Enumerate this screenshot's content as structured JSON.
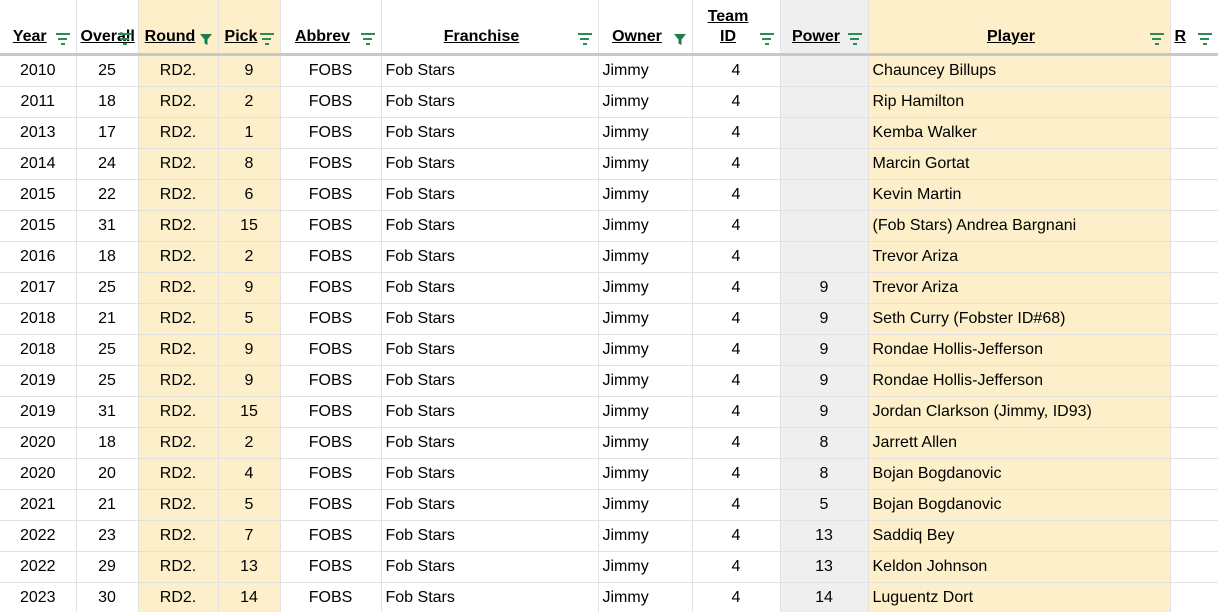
{
  "headers": {
    "year": "Year",
    "overall": "Overall",
    "round": "Round",
    "pick": "Pick",
    "abbrev": "Abbrev",
    "franchise": "Franchise",
    "owner": "Owner",
    "team_id_line1": "Team",
    "team_id_line2": "ID",
    "power": "Power",
    "player": "Player",
    "r": "R"
  },
  "colors": {
    "highlight_yellow": "#fcefc9",
    "highlight_gray": "#efefef",
    "filter_green": "#2e8b57",
    "grid": "#e2e2e2"
  },
  "rows": [
    {
      "year": "2010",
      "overall": "25",
      "round": "RD2.",
      "pick": "9",
      "abbrev": "FOBS",
      "franchise": "Fob Stars",
      "owner": "Jimmy",
      "team_id": "4",
      "power": "",
      "player": "Chauncey Billups",
      "r": ""
    },
    {
      "year": "2011",
      "overall": "18",
      "round": "RD2.",
      "pick": "2",
      "abbrev": "FOBS",
      "franchise": "Fob Stars",
      "owner": "Jimmy",
      "team_id": "4",
      "power": "",
      "player": "Rip Hamilton",
      "r": ""
    },
    {
      "year": "2013",
      "overall": "17",
      "round": "RD2.",
      "pick": "1",
      "abbrev": "FOBS",
      "franchise": "Fob Stars",
      "owner": "Jimmy",
      "team_id": "4",
      "power": "",
      "player": "Kemba Walker",
      "r": ""
    },
    {
      "year": "2014",
      "overall": "24",
      "round": "RD2.",
      "pick": "8",
      "abbrev": "FOBS",
      "franchise": "Fob Stars",
      "owner": "Jimmy",
      "team_id": "4",
      "power": "",
      "player": "Marcin Gortat",
      "r": ""
    },
    {
      "year": "2015",
      "overall": "22",
      "round": "RD2.",
      "pick": "6",
      "abbrev": "FOBS",
      "franchise": "Fob Stars",
      "owner": "Jimmy",
      "team_id": "4",
      "power": "",
      "player": "Kevin Martin",
      "r": ""
    },
    {
      "year": "2015",
      "overall": "31",
      "round": "RD2.",
      "pick": "15",
      "abbrev": "FOBS",
      "franchise": "Fob Stars",
      "owner": "Jimmy",
      "team_id": "4",
      "power": "",
      "player": "(Fob Stars) Andrea Bargnani",
      "r": ""
    },
    {
      "year": "2016",
      "overall": "18",
      "round": "RD2.",
      "pick": "2",
      "abbrev": "FOBS",
      "franchise": "Fob Stars",
      "owner": "Jimmy",
      "team_id": "4",
      "power": "",
      "player": "Trevor Ariza",
      "r": ""
    },
    {
      "year": "2017",
      "overall": "25",
      "round": "RD2.",
      "pick": "9",
      "abbrev": "FOBS",
      "franchise": "Fob Stars",
      "owner": "Jimmy",
      "team_id": "4",
      "power": "9",
      "player": "Trevor Ariza",
      "r": ""
    },
    {
      "year": "2018",
      "overall": "21",
      "round": "RD2.",
      "pick": "5",
      "abbrev": "FOBS",
      "franchise": "Fob Stars",
      "owner": "Jimmy",
      "team_id": "4",
      "power": "9",
      "player": "Seth Curry (Fobster ID#68)",
      "r": ""
    },
    {
      "year": "2018",
      "overall": "25",
      "round": "RD2.",
      "pick": "9",
      "abbrev": "FOBS",
      "franchise": "Fob Stars",
      "owner": "Jimmy",
      "team_id": "4",
      "power": "9",
      "player": "Rondae Hollis-Jefferson",
      "r": ""
    },
    {
      "year": "2019",
      "overall": "25",
      "round": "RD2.",
      "pick": "9",
      "abbrev": "FOBS",
      "franchise": "Fob Stars",
      "owner": "Jimmy",
      "team_id": "4",
      "power": "9",
      "player": "Rondae Hollis-Jefferson",
      "r": ""
    },
    {
      "year": "2019",
      "overall": "31",
      "round": "RD2.",
      "pick": "15",
      "abbrev": "FOBS",
      "franchise": "Fob Stars",
      "owner": "Jimmy",
      "team_id": "4",
      "power": "9",
      "player": "Jordan Clarkson (Jimmy, ID93)",
      "r": ""
    },
    {
      "year": "2020",
      "overall": "18",
      "round": "RD2.",
      "pick": "2",
      "abbrev": "FOBS",
      "franchise": "Fob Stars",
      "owner": "Jimmy",
      "team_id": "4",
      "power": "8",
      "player": "Jarrett Allen",
      "r": ""
    },
    {
      "year": "2020",
      "overall": "20",
      "round": "RD2.",
      "pick": "4",
      "abbrev": "FOBS",
      "franchise": "Fob Stars",
      "owner": "Jimmy",
      "team_id": "4",
      "power": "8",
      "player": "Bojan Bogdanovic",
      "r": ""
    },
    {
      "year": "2021",
      "overall": "21",
      "round": "RD2.",
      "pick": "5",
      "abbrev": "FOBS",
      "franchise": "Fob Stars",
      "owner": "Jimmy",
      "team_id": "4",
      "power": "5",
      "player": "Bojan Bogdanovic",
      "r": ""
    },
    {
      "year": "2022",
      "overall": "23",
      "round": "RD2.",
      "pick": "7",
      "abbrev": "FOBS",
      "franchise": "Fob Stars",
      "owner": "Jimmy",
      "team_id": "4",
      "power": "13",
      "player": "Saddiq Bey",
      "r": ""
    },
    {
      "year": "2022",
      "overall": "29",
      "round": "RD2.",
      "pick": "13",
      "abbrev": "FOBS",
      "franchise": "Fob Stars",
      "owner": "Jimmy",
      "team_id": "4",
      "power": "13",
      "player": "Keldon Johnson",
      "r": ""
    },
    {
      "year": "2023",
      "overall": "30",
      "round": "RD2.",
      "pick": "14",
      "abbrev": "FOBS",
      "franchise": "Fob Stars",
      "owner": "Jimmy",
      "team_id": "4",
      "power": "14",
      "player": "Luguentz Dort",
      "r": ""
    }
  ]
}
